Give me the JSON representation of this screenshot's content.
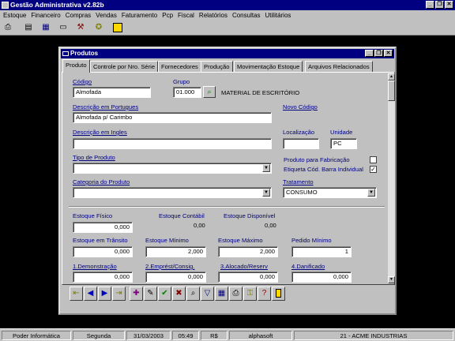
{
  "app": {
    "title": "Gestão Administrativa v2.82b",
    "caption_buttons": {
      "minimize": "_",
      "restore": "❐",
      "close": "✕"
    }
  },
  "menu": [
    "Estoque",
    "Financeiro",
    "Compras",
    "Vendas",
    "Faturamento",
    "Pcp",
    "Fiscal",
    "Relatórios",
    "Consultas",
    "Utilitários"
  ],
  "toolbar": [
    "printer-icon",
    "calculator-icon",
    "spreadsheet-icon",
    "card-icon",
    "tools-icon",
    "lightbulb-icon",
    "exit-door-icon"
  ],
  "window": {
    "title": "Produtos",
    "tabs": [
      "Produto",
      "Controle por Nro. Série",
      "Fornecedores",
      "Produção",
      "Movimentação Estoque",
      "Arquivos Relacionados"
    ],
    "active_tab": "Produto"
  },
  "form": {
    "codigo": {
      "label": "Código",
      "value": "Almofada"
    },
    "grupo": {
      "label": "Grupo",
      "value": "01.000",
      "description": "MATERIAL DE ESCRITÓRIO"
    },
    "descricao_pt": {
      "label": "Descrição em Portugues",
      "value": "Almofada p/ Carimbo"
    },
    "novo_codigo": {
      "label": "Novo Código"
    },
    "descricao_en": {
      "label": "Descrição em Ingles",
      "value": ""
    },
    "localizacao": {
      "label": "Localização",
      "value": ""
    },
    "unidade": {
      "label": "Unidade",
      "value": "PC"
    },
    "tipo": {
      "label": "Tipo de Produto",
      "value": ""
    },
    "produto_fabricacao": {
      "label": "Produto para Fabricação",
      "checked": false
    },
    "etiqueta": {
      "label": "Etiqueta Cód. Barra Individual",
      "checked": true
    },
    "categoria": {
      "label": "Categoria do Produto",
      "value": ""
    },
    "tratamento": {
      "label": "Tratamento",
      "value": "CONSUMO"
    },
    "estoque_fisico": {
      "label": "Estoque Físico",
      "value": "0,000"
    },
    "estoque_contabil": {
      "label": "Estoque Contábil",
      "value": "0,00"
    },
    "estoque_disponivel": {
      "label": "Estoque Disponível",
      "value": "0,00"
    },
    "estoque_transito": {
      "label": "Estoque em Trânsito",
      "value": "0,000"
    },
    "estoque_minimo": {
      "label": "Estoque Mínimo",
      "value": "2,000"
    },
    "estoque_maximo": {
      "label": "Estoque Máximo",
      "value": "2,000"
    },
    "pedido_minimo": {
      "label": "Pedido Mínimo",
      "value": "1"
    },
    "demonstracao": {
      "label": "1.Demonstração",
      "value": "0,000"
    },
    "emprest": {
      "label": "2.Emprést/Consig.",
      "value": "0,000"
    },
    "alocado": {
      "label": "3.Alocado/Reserv",
      "value": "0,000"
    },
    "danificado": {
      "label": "4.Danificado",
      "value": "0,000"
    }
  },
  "nav_buttons": [
    "first-record-icon",
    "previous-icon",
    "next-icon",
    "last-record-icon",
    "new-icon",
    "edit-icon",
    "save-icon",
    "delete-icon",
    "search-icon",
    "filter-icon",
    "grid-icon",
    "print-icon",
    "lock-icon",
    "help-icon",
    "exit-icon"
  ],
  "status": [
    "Poder Informática",
    "Segunda",
    "31/03/2003",
    "05:49",
    "R$",
    "alphasoft",
    "21 - ACME INDUSTRIAS"
  ],
  "colors": {
    "title_bar": "#000080",
    "desktop": "#000000",
    "window_face": "#c0c0c0",
    "link": "#000080"
  }
}
